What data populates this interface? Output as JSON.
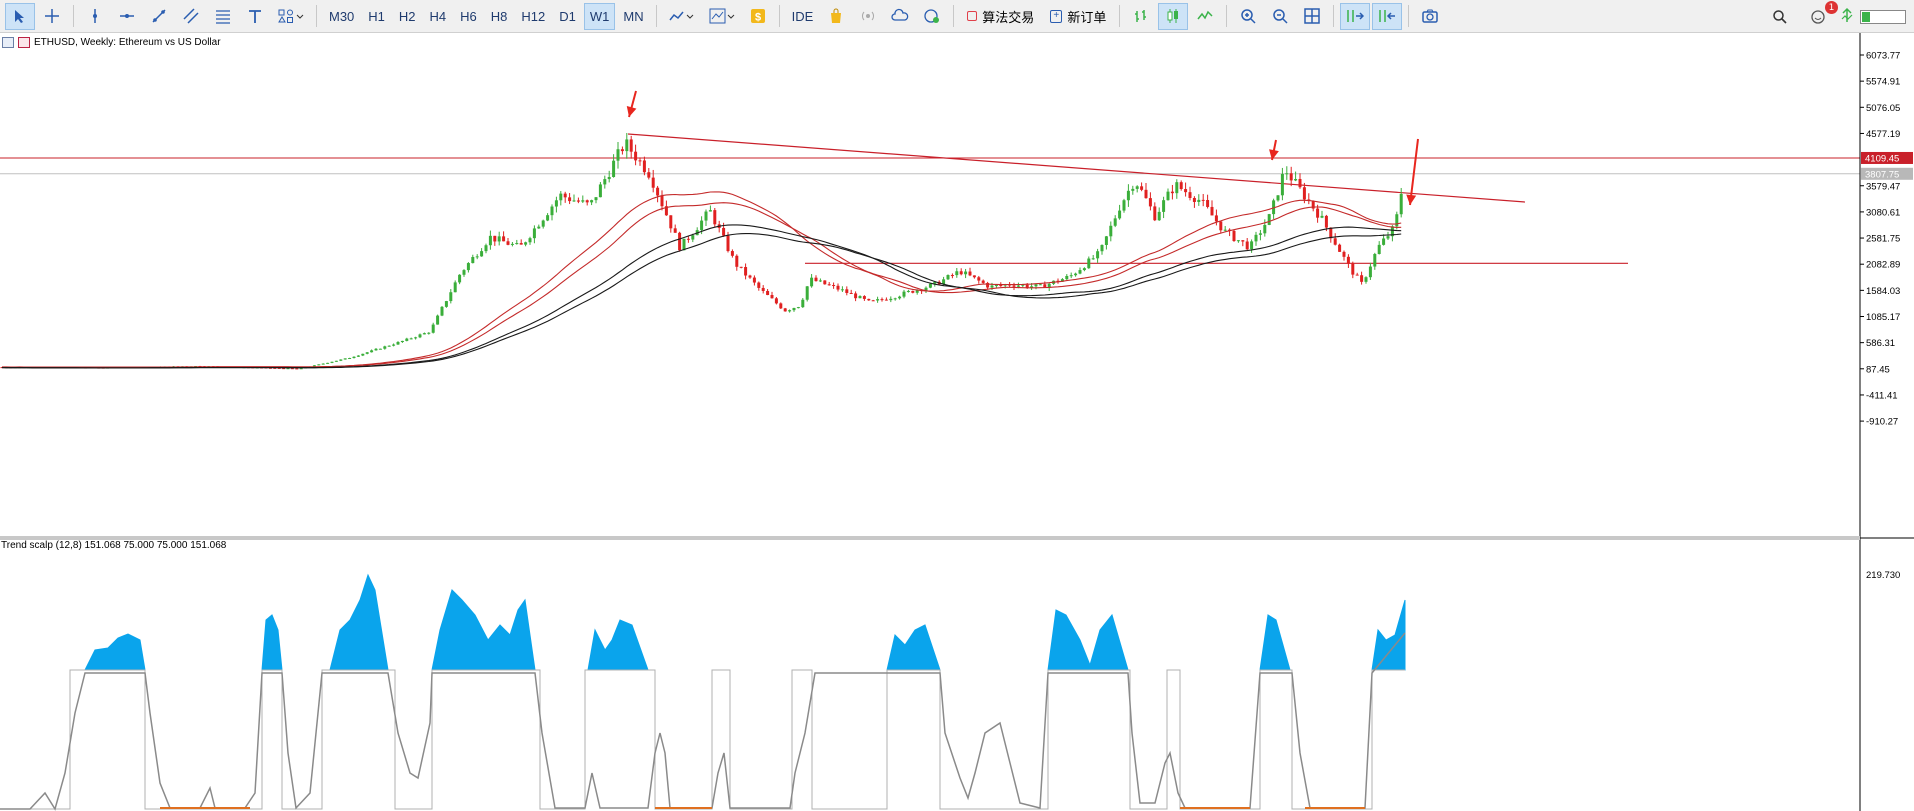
{
  "toolbar": {
    "timeframes": [
      "M30",
      "H1",
      "H2",
      "H4",
      "H6",
      "H8",
      "H12",
      "D1",
      "W1",
      "MN"
    ],
    "active_timeframe": "W1",
    "ide_label": "IDE",
    "algo_trading_label": "算法交易",
    "new_order_label": "新订单",
    "notification_count": "1"
  },
  "chart": {
    "symbol_title": "ETHUSD, Weekly:  Ethereum vs US Dollar",
    "price_labels": [
      "6073.77",
      "5574.91",
      "5076.05",
      "4577.19",
      "3579.47",
      "3080.61",
      "2581.75",
      "2082.89",
      "1584.03",
      "1085.17",
      "586.31",
      "87.45",
      "-411.41",
      "-910.27"
    ],
    "resistance_label": "4109.45",
    "current_price_label": "3807.75",
    "resistance_price": 4109.45,
    "current_price": 3807.75,
    "support_price": 2100,
    "colors": {
      "bull": "#3aae3a",
      "bear": "#e02020",
      "resistance": "#c9202a",
      "ma_red": "#c42a2a",
      "ma_black": "#1a1a1a"
    }
  },
  "indicator": {
    "title": "Trend scalp (12,8) 151.068 75.000 75.000 151.068",
    "scale_label": "219.730",
    "colors": {
      "fill": "#0aa4ec",
      "line": "#8a8a8a",
      "low": "#e07020"
    }
  }
}
